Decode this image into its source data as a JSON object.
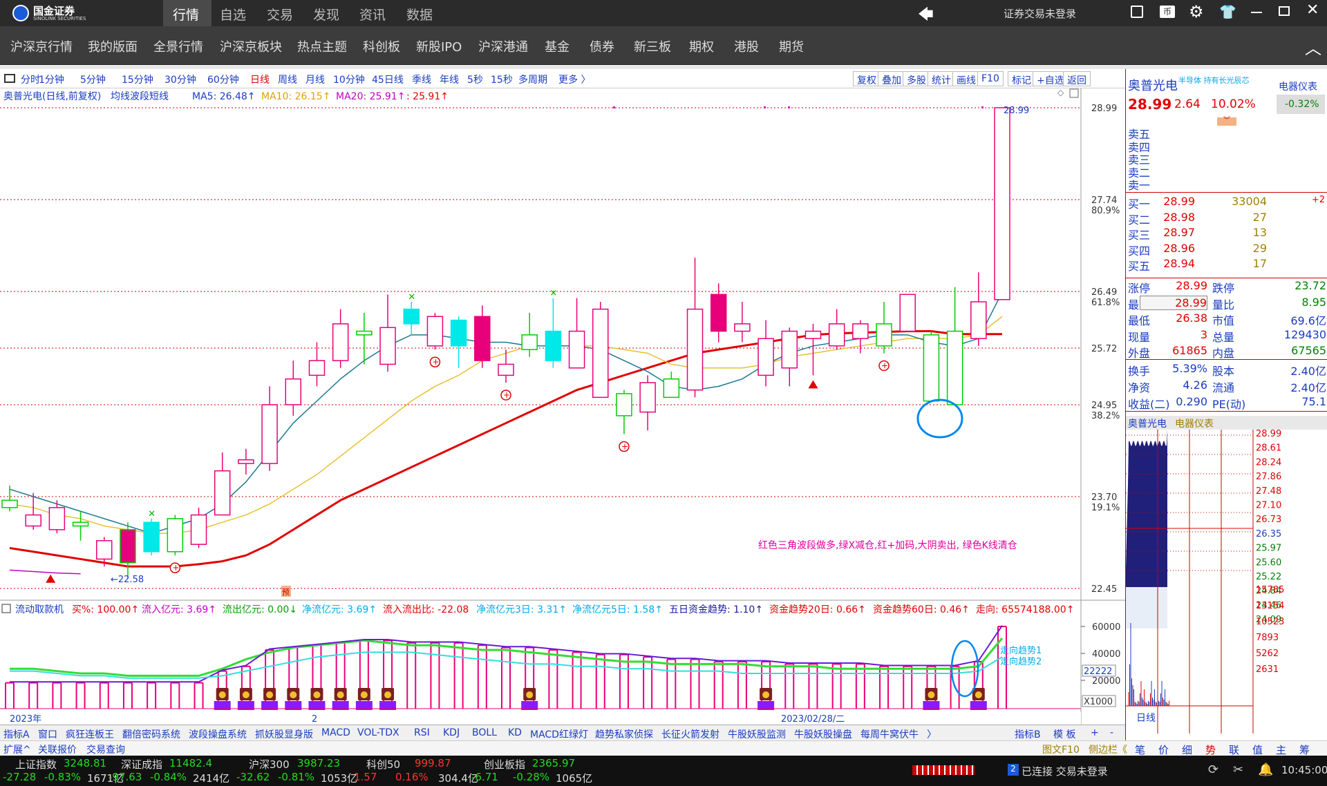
{
  "app": {
    "logo_text": "国金证券",
    "logo_sub": "SINOLINK SECURITIES",
    "account_status": "证券交易未登录",
    "top_tabs": [
      "行情",
      "自选",
      "交易",
      "发现",
      "资讯",
      "数据"
    ]
  },
  "nav": [
    "沪深京行情",
    "我的版面",
    "全景行情",
    "沪深京板块",
    "热点主题",
    "科创板",
    "新股IPO",
    "沪深港通",
    "基金",
    "债券",
    "新三板",
    "期权",
    "港股",
    "期货"
  ],
  "periods": [
    "分时",
    "1分钟",
    "5分钟",
    "15分钟",
    "30分钟",
    "60分钟",
    "日线",
    "周线",
    "月线",
    "10分钟",
    "45日线",
    "季线",
    "年线",
    "5秒",
    "15秒",
    "多周期",
    "更多 〉"
  ],
  "active_period": "日线",
  "tools": [
    "复权",
    "叠加",
    "多股",
    "统计",
    "画线",
    "F10",
    "标记",
    "+自选",
    "返回"
  ],
  "chart_header": {
    "name": "奥普光电(日线,前复权)",
    "indicator": "均线波段短线",
    "ma5": "MA5: 26.48↑",
    "ma10": "MA10: 26.15↑",
    "ma20": "MA20: 25.91↑",
    "extra": ": 25.91↑"
  },
  "annotation": "红色三角波段做多,绿X减仓,红+加码,大阴卖出, 绿色K线清仓",
  "price_axis": {
    "ticks": [
      "28.99",
      "27.74",
      "26.49",
      "25.72",
      "24.95",
      "23.70",
      "22.45"
    ],
    "pct": [
      "80.9%",
      "61.8%",
      "38.2%",
      "19.1%"
    ]
  },
  "high_label": "28.99",
  "low_label": "←22.58",
  "ind_badge": "预",
  "sub_header": {
    "name": "流动取款机",
    "buy": "买%: 100.00↑",
    "inflow": "流入亿元: 3.69↑",
    "outflow": "流出亿元: 0.00↓",
    "net": "净流亿元: 3.69↑",
    "ratio": "流入流出比: -22.08",
    "net3": "净流亿元3日: 3.31↑",
    "net5": "净流亿元5日: 1.58↑",
    "trend5": "五日资金趋势: 1.10↑",
    "trend20": "资金趋势20日: 0.66↑",
    "trend60": "资金趋势60日: 0.46↑",
    "direction": "走向: 65574188.00↑"
  },
  "sub_axis": {
    "ticks": [
      "60000",
      "40000",
      "20000"
    ],
    "extra": "22222",
    "unit": "X1000"
  },
  "sub_labels": {
    "trend1": "走向趋势1",
    "trend2": "走向趋势2"
  },
  "date_labels": {
    "year": "2023年",
    "mid": "2",
    "date": "2023/02/28/二"
  },
  "quote": {
    "name": "奥普光电",
    "tags": "半导体  持有长光辰芯",
    "sector": "电器仪表",
    "sector_chg": "-0.32%",
    "price": "28.99",
    "change": "2.64",
    "pct": "10.02%",
    "asks": [
      {
        "l": "卖五"
      },
      {
        "l": "卖四"
      },
      {
        "l": "卖三"
      },
      {
        "l": "卖二"
      },
      {
        "l": "卖一"
      }
    ],
    "bids": [
      {
        "l": "买一",
        "p": "28.99",
        "v": "33004",
        "x": "+2"
      },
      {
        "l": "买二",
        "p": "28.98",
        "v": "27"
      },
      {
        "l": "买三",
        "p": "28.97",
        "v": "13"
      },
      {
        "l": "买四",
        "p": "28.96",
        "v": "29"
      },
      {
        "l": "买五",
        "p": "28.94",
        "v": "17"
      }
    ],
    "stats": [
      [
        "涨停",
        "28.99",
        "跌停",
        "23.72"
      ],
      [
        "最高",
        "28.99",
        "量比",
        "8.95"
      ],
      [
        "最低",
        "26.38",
        "市值",
        "69.6亿"
      ],
      [
        "现量",
        "3",
        "总量",
        "129430"
      ],
      [
        "外盘",
        "61865",
        "内盘",
        "67565"
      ]
    ],
    "stats2": [
      [
        "换手",
        "5.39%",
        "股本",
        "2.40亿"
      ],
      [
        "净资",
        "4.26",
        "流通",
        "2.40亿"
      ],
      [
        "收益(二)",
        "0.290",
        "PE(动)",
        "75.1"
      ]
    ],
    "mini_title": "奥普光电",
    "mini_sector": "电器仪表",
    "mini_ticks": [
      "28.99",
      "28.61",
      "28.24",
      "27.86",
      "27.48",
      "27.10",
      "26.73",
      "26.35",
      "25.97",
      "25.60",
      "25.22",
      "24.84",
      "24.46",
      "24.09",
      "15785",
      "13154",
      "10523",
      "7893",
      "5262",
      "2631"
    ],
    "mini_tab": "日线"
  },
  "ind_tabs": [
    "指标A",
    "窗口",
    "疯狂连板王",
    "翻倍密码系统",
    "波段操盘系统",
    "抓妖股显身版",
    "MACD",
    "VOL-TDX",
    "RSI",
    "KDJ",
    "BOLL",
    "KD",
    "MACD红绿灯",
    "趋势私家侦探",
    "长征火箭发射",
    "牛股妖股监测",
    "牛股妖股操盘",
    "每周牛窝伏牛",
    "〉"
  ],
  "ind_right": [
    "指标B",
    "模 板",
    "+",
    "-"
  ],
  "sub_tabs": [
    "扩展^",
    "关联报价",
    "交易查询"
  ],
  "side_tabs": [
    "图文F10",
    "侧边栏《"
  ],
  "side_btns": [
    "笔",
    "价",
    "细",
    "势",
    "联",
    "值",
    "主",
    "筹"
  ],
  "indices": [
    {
      "n": "上证指数",
      "v": "3248.81",
      "c": "-27.28",
      "p": "-0.83%",
      "a": "1671亿"
    },
    {
      "n": "深证成指",
      "v": "11482.4",
      "c": "-97.63",
      "p": "-0.84%",
      "a": "2414亿"
    },
    {
      "n": "沪深300",
      "v": "3987.23",
      "c": "-32.62",
      "p": "-0.81%",
      "a": "1053亿"
    },
    {
      "n": "科创50",
      "v": "999.87",
      "c": "1.57",
      "p": "0.16%",
      "a": "304.4亿"
    },
    {
      "n": "创业板指",
      "v": "2365.97",
      "c": "-6.71",
      "p": "-0.28%",
      "a": "1065亿"
    }
  ],
  "conn": "已连接 交易未登录",
  "conn_num": "2",
  "time": "10:45:00",
  "chart_data": {
    "type": "candlestick",
    "candles": [
      [
        23.65,
        23.55,
        23.85,
        23.5
      ],
      [
        23.3,
        23.45,
        23.75,
        23.25
      ],
      [
        23.25,
        23.55,
        23.65,
        23.2
      ],
      [
        23.35,
        23.3,
        23.5,
        23.1
      ],
      [
        22.85,
        23.1,
        23.15,
        22.75
      ],
      [
        23.25,
        22.8,
        23.35,
        22.58
      ],
      [
        22.95,
        23.35,
        23.4,
        22.9
      ],
      [
        23.4,
        22.95,
        23.45,
        22.9
      ],
      [
        23.05,
        23.45,
        23.55,
        23.0
      ],
      [
        23.45,
        24.05,
        24.3,
        23.45
      ],
      [
        24.15,
        24.2,
        24.35,
        24.0
      ],
      [
        24.15,
        24.95,
        25.2,
        24.05
      ],
      [
        24.95,
        25.3,
        25.55,
        24.8
      ],
      [
        25.35,
        25.55,
        25.8,
        25.2
      ],
      [
        25.55,
        26.05,
        26.25,
        25.45
      ],
      [
        25.95,
        25.9,
        26.2,
        25.5
      ],
      [
        25.5,
        26.0,
        26.45,
        25.4
      ],
      [
        26.05,
        26.25,
        26.35,
        25.9
      ],
      [
        25.75,
        26.15,
        26.2,
        25.7
      ],
      [
        26.1,
        25.75,
        26.15,
        25.45
      ],
      [
        25.55,
        26.15,
        26.3,
        25.45
      ],
      [
        25.35,
        25.5,
        25.7,
        25.25
      ],
      [
        25.9,
        25.7,
        26.2,
        25.6
      ],
      [
        25.95,
        25.55,
        26.4,
        25.45
      ],
      [
        25.45,
        25.95,
        26.4,
        25.5
      ],
      [
        25.05,
        26.25,
        26.35,
        25.05
      ],
      [
        25.1,
        24.8,
        25.15,
        24.55
      ],
      [
        24.85,
        25.25,
        25.35,
        24.6
      ],
      [
        25.3,
        25.05,
        25.4,
        25.2
      ],
      [
        25.15,
        26.25,
        26.95,
        25.05
      ],
      [
        26.45,
        25.95,
        26.6,
        25.8
      ],
      [
        25.95,
        26.05,
        26.35,
        25.8
      ],
      [
        25.35,
        25.85,
        26.1,
        25.2
      ],
      [
        25.45,
        25.95,
        26.0,
        25.2
      ],
      [
        25.85,
        25.95,
        26.05,
        25.35
      ],
      [
        25.75,
        26.05,
        26.25,
        25.7
      ],
      [
        25.85,
        26.05,
        26.1,
        25.65
      ],
      [
        26.05,
        25.75,
        26.35,
        25.65
      ],
      [
        25.95,
        26.45,
        26.45,
        25.95
      ],
      [
        25.9,
        25.0,
        25.95,
        25.0
      ],
      [
        25.95,
        24.95,
        26.55,
        24.95
      ],
      [
        25.85,
        26.35,
        26.75,
        25.75
      ],
      [
        26.38,
        28.99,
        28.99,
        26.38
      ]
    ],
    "ma5": [
      23.8,
      23.7,
      23.6,
      23.5,
      23.4,
      23.3,
      23.2,
      23.3,
      23.4,
      23.6,
      23.9,
      24.3,
      24.7,
      25.0,
      25.3,
      25.55,
      25.75,
      25.9,
      25.9,
      25.85,
      25.8,
      25.8,
      25.75,
      25.75,
      25.75,
      25.7,
      25.55,
      25.4,
      25.2,
      25.15,
      25.2,
      25.3,
      25.5,
      25.65,
      25.75,
      25.8,
      25.85,
      25.9,
      25.9,
      25.8,
      25.75,
      25.85,
      26.48
    ],
    "ma10": [
      23.6,
      23.55,
      23.45,
      23.4,
      23.3,
      23.25,
      23.2,
      23.2,
      23.25,
      23.35,
      23.45,
      23.6,
      23.8,
      24.0,
      24.25,
      24.5,
      24.75,
      25.0,
      25.2,
      25.35,
      25.55,
      25.65,
      25.75,
      25.75,
      25.75,
      25.75,
      25.7,
      25.65,
      25.5,
      25.45,
      25.45,
      25.45,
      25.5,
      25.6,
      25.65,
      25.7,
      25.75,
      25.8,
      25.85,
      25.85,
      25.85,
      25.9,
      26.15
    ],
    "ma20": [
      23.0,
      22.95,
      22.9,
      22.85,
      22.8,
      22.75,
      22.75,
      22.75,
      22.78,
      22.82,
      22.9,
      23.05,
      23.25,
      23.45,
      23.65,
      23.8,
      23.95,
      24.1,
      24.25,
      24.4,
      24.55,
      24.7,
      24.85,
      25.0,
      25.15,
      25.25,
      25.35,
      25.45,
      25.55,
      25.65,
      25.7,
      25.75,
      25.8,
      25.85,
      25.9,
      25.92,
      25.93,
      25.94,
      25.95,
      25.95,
      25.91,
      25.91,
      25.91
    ],
    "upper": [
      22.7,
      22.68,
      22.66,
      22.65
    ],
    "sub_bars": [
      11,
      11,
      11,
      11,
      11,
      11,
      11,
      11,
      11,
      16,
      18,
      25,
      26,
      27,
      28,
      29,
      29,
      28,
      28,
      28,
      27,
      26,
      26,
      25,
      24,
      23,
      23,
      22,
      21,
      21,
      20,
      20,
      20,
      19,
      19,
      19,
      19,
      18,
      18,
      18,
      18,
      20,
      35
    ],
    "sub_green": [
      17,
      17,
      16,
      15,
      15,
      14,
      14,
      14,
      14,
      17,
      21,
      24,
      26,
      27,
      28,
      29,
      28,
      27,
      27,
      26,
      25,
      25,
      24,
      23,
      22,
      21,
      20,
      20,
      19,
      19,
      19,
      19,
      18,
      18,
      18,
      17,
      17,
      17,
      17,
      17,
      17,
      18,
      30
    ],
    "sub_cyan": [
      16,
      16,
      15,
      14,
      14,
      13,
      13,
      13,
      13,
      14,
      16,
      18,
      20,
      22,
      23,
      24,
      24,
      24,
      23,
      22,
      21,
      20,
      19,
      19,
      18,
      18,
      17,
      17,
      16,
      16,
      16,
      15,
      15,
      15,
      15,
      15,
      15,
      15,
      15,
      15,
      15,
      16,
      22
    ],
    "buy_signals": [
      9,
      10,
      11,
      12,
      13,
      14,
      15,
      16,
      22,
      32,
      39,
      41
    ],
    "plus_signals": [
      7,
      18,
      21,
      26,
      37
    ],
    "x_signals": [
      6,
      17,
      23
    ],
    "triangles": [
      1,
      34
    ]
  }
}
